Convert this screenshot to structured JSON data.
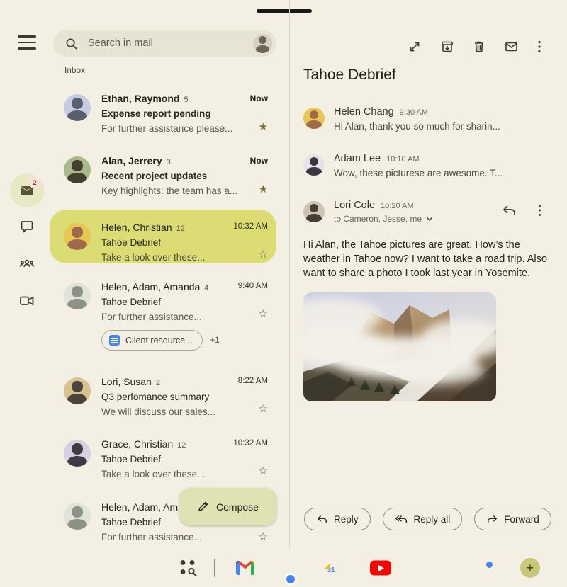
{
  "search": {
    "placeholder": "Search in mail"
  },
  "left_rail": {
    "badge_count": "2"
  },
  "inbox": {
    "label": "Inbox",
    "items": [
      {
        "senders": "Ethan, Raymond",
        "count": "5",
        "time": "Now",
        "subject": "Expense report pending",
        "preview": "For further assistance please...",
        "starred": true
      },
      {
        "senders": "Alan, Jerrery",
        "count": "3",
        "time": "Now",
        "subject": "Recent project updates",
        "preview": "Key highlights: the team has a...",
        "starred": true
      },
      {
        "senders": "Helen, Christian",
        "count": "12",
        "time": "10:32 AM",
        "subject": "Tahoe Debrief",
        "preview": "Take a look over these...",
        "starred": false,
        "selected": true
      },
      {
        "senders": "Helen, Adam, Amanda",
        "count": "4",
        "time": "9:40 AM",
        "subject": "Tahoe Debrief",
        "preview": "For further assistance...",
        "starred": false,
        "attachment": "Client resource...",
        "attachment_extra": "+1"
      },
      {
        "senders": "Lori, Susan",
        "count": "2",
        "time": "8:22 AM",
        "subject": "Q3 perfomance summary",
        "preview": "We will discuss our sales...",
        "starred": false
      },
      {
        "senders": "Grace, Christian",
        "count": "12",
        "time": "10:32 AM",
        "subject": "Tahoe Debrief",
        "preview": "Take a look over these...",
        "starred": false
      },
      {
        "senders": "Helen, Adam, Am",
        "subject": "Tahoe Debrief",
        "preview": "For further assistance...",
        "starred": false
      }
    ]
  },
  "compose": {
    "label": "Compose"
  },
  "thread": {
    "title": "Tahoe Debrief",
    "messages": [
      {
        "sender": "Helen Chang",
        "time": "9:30 AM",
        "preview": "Hi Alan, thank you so much for sharin..."
      },
      {
        "sender": "Adam Lee",
        "time": "10:10 AM",
        "preview": "Wow, these picturese are awesome. T..."
      },
      {
        "sender": "Lori Cole",
        "time": "10:20 AM",
        "recipients": "to Cameron, Jesse, me"
      }
    ],
    "body": "Hi Alan, the Tahoe pictures are great. How’s the weather in Tahoe now? I want to take a road trip. Also want to share a photo I took last year in Yosemite.",
    "actions": {
      "reply": "Reply",
      "reply_all": "Reply all",
      "forward": "Forward"
    }
  },
  "taskbar": {
    "calendar_day": "31"
  },
  "colors": {
    "background": "#f3efe2",
    "search_bar": "#e8e4d3",
    "selected_row": "#dbdc74",
    "compose_button": "#dfe3b3",
    "rail_selected_circle": "#e9e8c4",
    "star_filled": "#76752f",
    "doc_chip_blue": "#4285f4",
    "youtube_red": "#ff0000"
  }
}
